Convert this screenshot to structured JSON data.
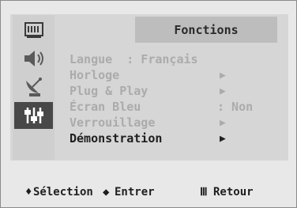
{
  "menu": {
    "title": "Fonctions",
    "items": [
      {
        "label": "Langue  : Français",
        "arrow": "",
        "value": "",
        "active": false
      },
      {
        "label": "Horloge",
        "arrow": "▶",
        "value": "",
        "active": false
      },
      {
        "label": "Plug & Play",
        "arrow": "▶",
        "value": "",
        "active": false
      },
      {
        "label": "Écran Bleu",
        "arrow": "",
        "value": ": Non",
        "active": false
      },
      {
        "label": "Verrouillage",
        "arrow": "▶",
        "value": "",
        "active": false
      },
      {
        "label": "Démonstration",
        "arrow": "▶",
        "value": "",
        "active": true
      }
    ]
  },
  "sidebar": {
    "icons": [
      {
        "name": "picture-icon",
        "active": false
      },
      {
        "name": "sound-icon",
        "active": false
      },
      {
        "name": "channel-antenna-icon",
        "active": false
      },
      {
        "name": "setup-functions-icon",
        "active": true
      }
    ]
  },
  "footer": {
    "select_icon": "♦",
    "select_label": "Sélection",
    "enter_icon": "◆",
    "enter_label": "Entrer",
    "return_icon": "Ⅲ",
    "return_label": "Retour"
  }
}
